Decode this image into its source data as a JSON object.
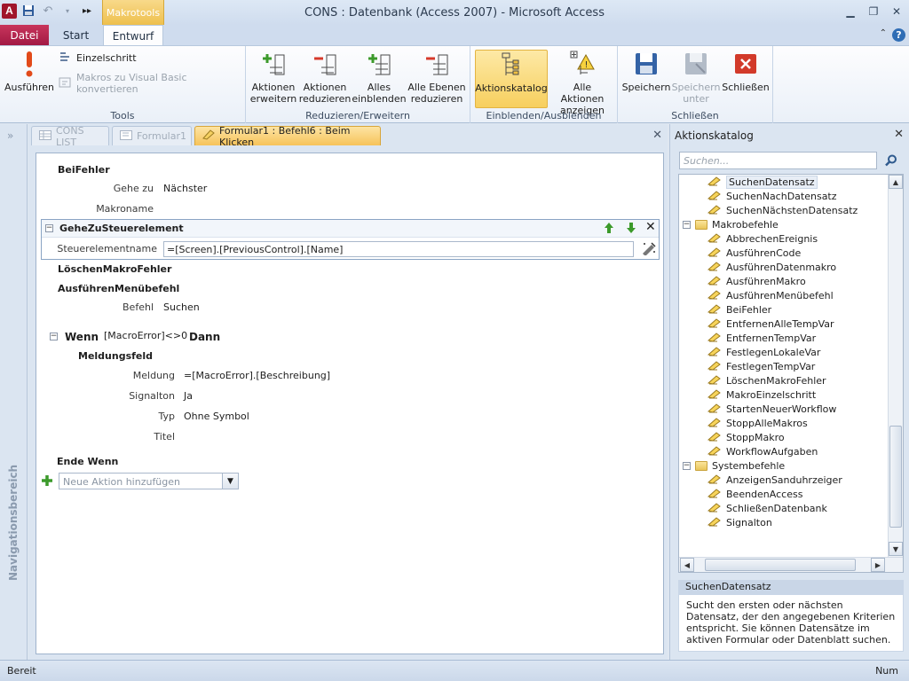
{
  "window": {
    "title": "CONS : Datenbank (Access 2007)  -  Microsoft Access",
    "contextual_tab_group": "Makrotools"
  },
  "ribbon_tabs": {
    "file": "Datei",
    "start": "Start",
    "entwurf": "Entwurf"
  },
  "ribbon": {
    "tools": {
      "label": "Tools",
      "run": "Ausführen",
      "single_step": "Einzelschritt",
      "convert": "Makros zu Visual Basic konvertieren"
    },
    "collapse_expand": {
      "label": "Reduzieren/Erweitern",
      "expand_actions_1": "Aktionen",
      "expand_actions_2": "erweitern",
      "collapse_actions_1": "Aktionen",
      "collapse_actions_2": "reduzieren",
      "expand_all_1": "Alles",
      "expand_all_2": "einblenden",
      "collapse_all_1": "Alle Ebenen",
      "collapse_all_2": "reduzieren"
    },
    "show_hide": {
      "label": "Einblenden/Ausblenden",
      "action_catalog": "Aktionskatalog",
      "show_all_1": "Alle Aktionen",
      "show_all_2": "anzeigen"
    },
    "close_group": {
      "label": "Schließen",
      "save": "Speichern",
      "save_as_1": "Speichern",
      "save_as_2": "unter",
      "close": "Schließen"
    }
  },
  "nav_pane": {
    "label": "Navigationsbereich"
  },
  "document_tabs": [
    {
      "label": "CONS LIST"
    },
    {
      "label": "Formular1"
    },
    {
      "label": "Formular1 : Befehl6 : Beim Klicken"
    }
  ],
  "macro": {
    "on_error": {
      "action": "BeiFehler",
      "goto_label": "Gehe zu",
      "goto_value": "Nächster",
      "macro_name_label": "Makroname",
      "macro_name_value": ""
    },
    "goto_control": {
      "action": "GeheZuSteuerelement",
      "control_name_label": "Steuerelementname",
      "control_name_value": "=[Screen].[PreviousControl].[Name]"
    },
    "clear_error": "LöschenMakroFehler",
    "run_menu": {
      "action": "AusführenMenübefehl",
      "command_label": "Befehl",
      "command_value": "Suchen"
    },
    "if_block": {
      "if_keyword": "Wenn",
      "condition": "[MacroError]<>0",
      "then_keyword": "Dann",
      "msgbox_action": "Meldungsfeld",
      "message_label": "Meldung",
      "message_value": "=[MacroError].[Beschreibung]",
      "beep_label": "Signalton",
      "beep_value": "Ja",
      "type_label": "Typ",
      "type_value": "Ohne Symbol",
      "title_label": "Titel",
      "title_value": "",
      "end_if": "Ende Wenn"
    },
    "add_action_placeholder": "Neue Aktion hinzufügen"
  },
  "catalog": {
    "title": "Aktionskatalog",
    "search_placeholder": "Suchen...",
    "tree": [
      {
        "type": "item",
        "label": "SuchenDatensatz",
        "selected": true
      },
      {
        "type": "item",
        "label": "SuchenNachDatensatz"
      },
      {
        "type": "item",
        "label": "SuchenNächstenDatensatz"
      },
      {
        "type": "folder",
        "label": "Makrobefehle"
      },
      {
        "type": "item",
        "label": "AbbrechenEreignis"
      },
      {
        "type": "item",
        "label": "AusführenCode"
      },
      {
        "type": "item",
        "label": "AusführenDatenmakro"
      },
      {
        "type": "item",
        "label": "AusführenMakro"
      },
      {
        "type": "item",
        "label": "AusführenMenübefehl"
      },
      {
        "type": "item",
        "label": "BeiFehler"
      },
      {
        "type": "item",
        "label": "EntfernenAlleTempVar"
      },
      {
        "type": "item",
        "label": "EntfernenTempVar"
      },
      {
        "type": "item",
        "label": "FestlegenLokaleVar"
      },
      {
        "type": "item",
        "label": "FestlegenTempVar"
      },
      {
        "type": "item",
        "label": "LöschenMakroFehler"
      },
      {
        "type": "item",
        "label": "MakroEinzelschritt"
      },
      {
        "type": "item",
        "label": "StartenNeuerWorkflow"
      },
      {
        "type": "item",
        "label": "StoppAlleMakros"
      },
      {
        "type": "item",
        "label": "StoppMakro"
      },
      {
        "type": "item",
        "label": "WorkflowAufgaben"
      },
      {
        "type": "folder",
        "label": "Systembefehle"
      },
      {
        "type": "item",
        "label": "AnzeigenSanduhrzeiger"
      },
      {
        "type": "item",
        "label": "BeendenAccess"
      },
      {
        "type": "item",
        "label": "SchließenDatenbank"
      },
      {
        "type": "item",
        "label": "Signalton"
      }
    ],
    "description_title": "SuchenDatensatz",
    "description_text": "Sucht den ersten oder nächsten Datensatz, der den angegebenen Kriterien entspricht. Sie können Datensätze im aktiven Formular oder Datenblatt suchen."
  },
  "status": {
    "left": "Bereit",
    "right": "Num"
  },
  "colors": {
    "file_tab": "#a11842",
    "contextual": "#eec04d",
    "accent": "#2f6db5"
  }
}
